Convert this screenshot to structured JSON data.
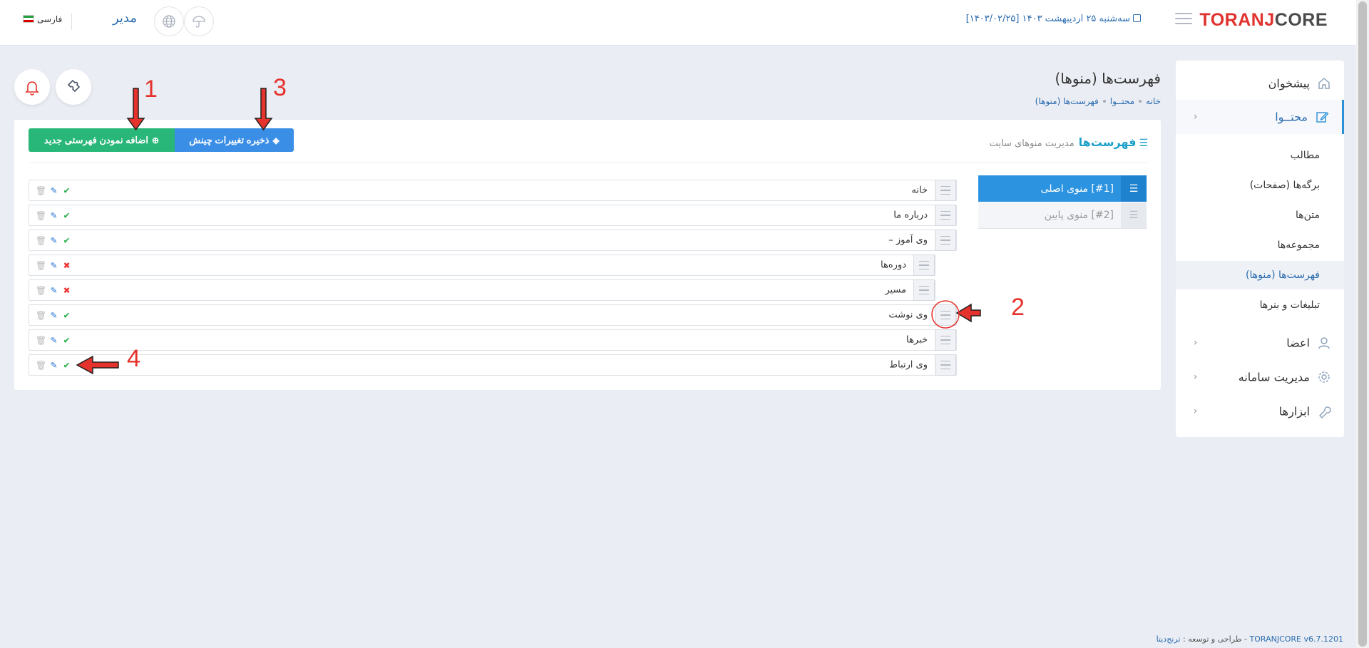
{
  "header": {
    "logo_part1": "TORANJ",
    "logo_part2": "CORE",
    "datetime": "سه‌شنبه ۲۵ اردیبهشت ۱۴۰۳ [۱۴۰۳/۰۲/۲۵]",
    "language": "فارسی",
    "user": "مدیر"
  },
  "sidebar": {
    "dashboard": "پیشخوان",
    "content": "محتــوا",
    "content_items": [
      "مطالب",
      "برگه‌ها (صفحات)",
      "متن‌ها",
      "مجموعه‌ها",
      "فهرست‌ها (منوها)",
      "تبلیغات و بنرها"
    ],
    "members": "اعضا",
    "system": "مدیریت سامانه",
    "tools": "ابزارها"
  },
  "page": {
    "title": "فهرست‌ها (منوها)",
    "breadcrumb": [
      "خانه",
      "محتــوا",
      "فهرست‌ها (منوها)"
    ]
  },
  "card": {
    "title": "فهرست‌ها",
    "subtitle": "مدیریت منوهای سایت",
    "add_button": "اضافه نمودن فهرستی جدید",
    "save_button": "ذخیره تغییرات چینش"
  },
  "menus": [
    {
      "label": "[#1] منوی اصلی"
    },
    {
      "label": "[#2] منوی پایین"
    }
  ],
  "rows": [
    {
      "label": "خانه",
      "status": "active"
    },
    {
      "label": "درباره ما",
      "status": "active"
    },
    {
      "label": "وی آموز",
      "status": "active",
      "expanded_glyph": "–"
    },
    {
      "label": "دوره‌ها",
      "status": "inactive"
    },
    {
      "label": "مسیر",
      "status": "inactive"
    },
    {
      "label": "وی نوشت",
      "status": "active"
    },
    {
      "label": "خبرها",
      "status": "active"
    },
    {
      "label": "وی ارتباط",
      "status": "active"
    }
  ],
  "annotations": [
    "1",
    "2",
    "3",
    "4"
  ],
  "footer": {
    "version": "TORANJCORE v6.7.1201",
    "text": " - طراحی و توسعه : ",
    "company": "ترنج‌دیتا"
  },
  "colors": {
    "accent": "#2b93e0",
    "green": "#28b779",
    "annotation": "#e5322c"
  }
}
